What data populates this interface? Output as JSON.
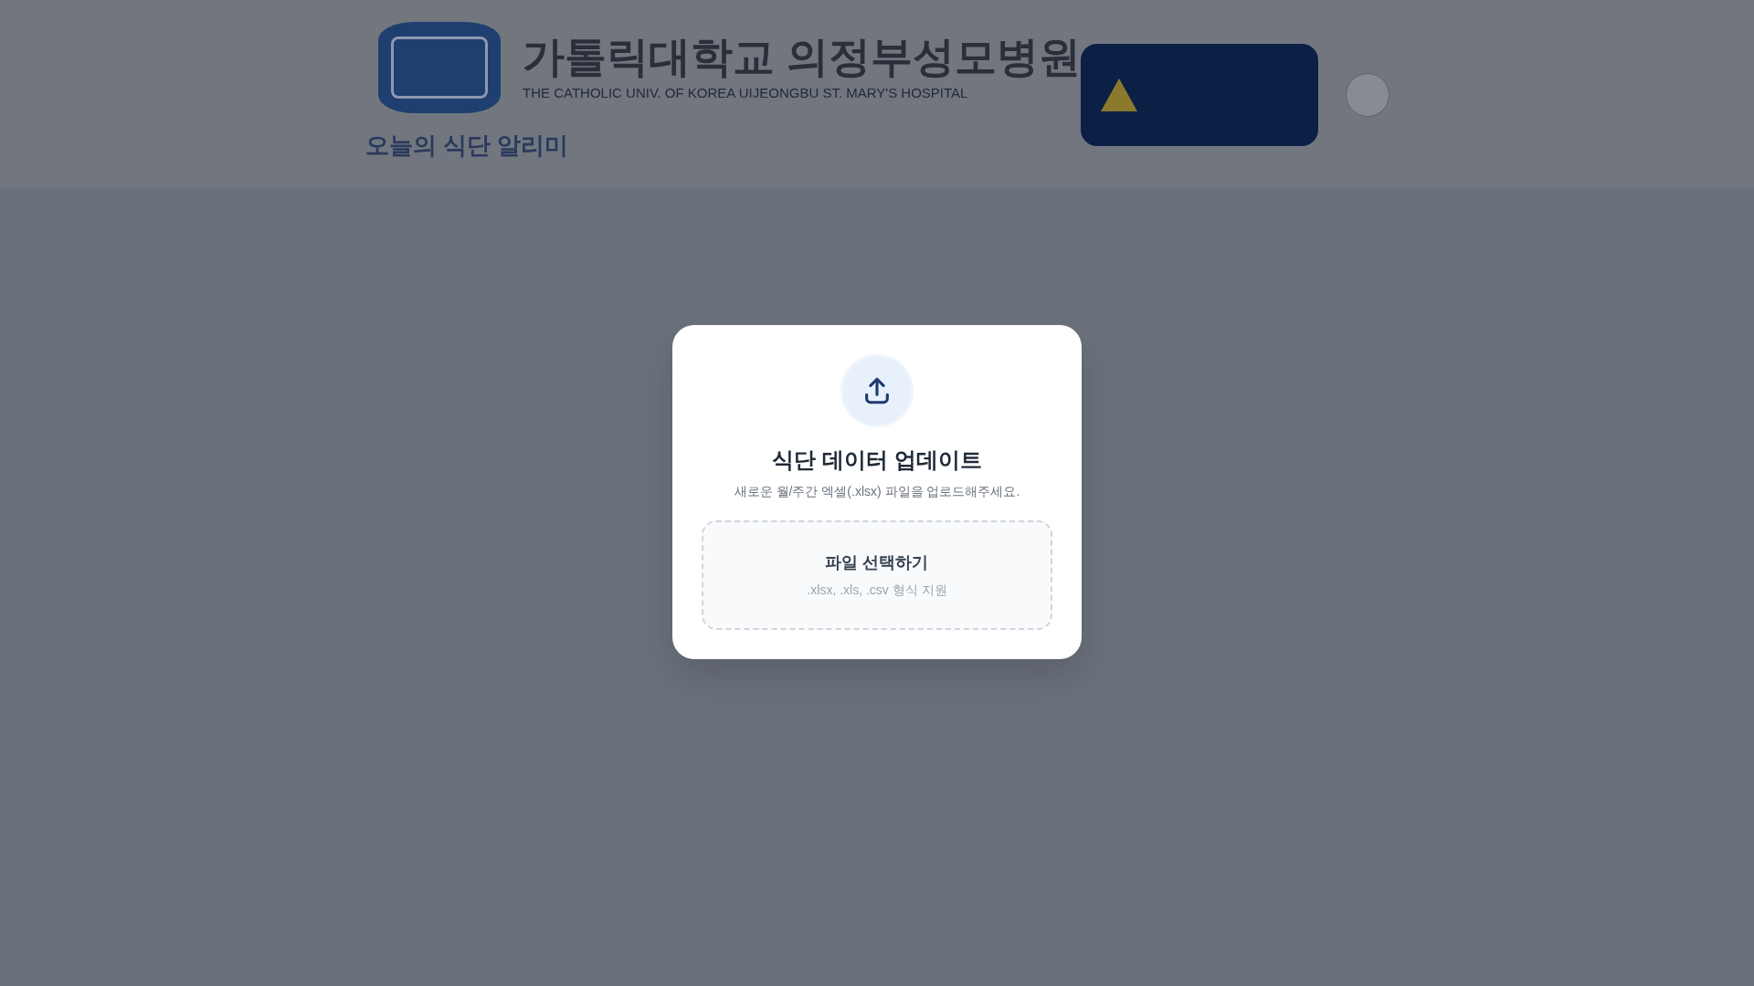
{
  "header": {
    "hospital_name": "가톨릭대학교 의정부성모병원",
    "hospital_name_en": "THE CATHOLIC UNIV. OF KOREA UIJEONGBU ST. MARY'S HOSPITAL",
    "page_title": "오늘의 식단 알리미"
  },
  "upload_dialog": {
    "title": "식단 데이터 업데이트",
    "description": "새로운 월/주간 엑셀(.xlsx) 파일을 업로드해주세요.",
    "dropzone": {
      "label": "파일 선택하기",
      "hint": ".xlsx, .xls, .csv 형식 지원"
    }
  }
}
